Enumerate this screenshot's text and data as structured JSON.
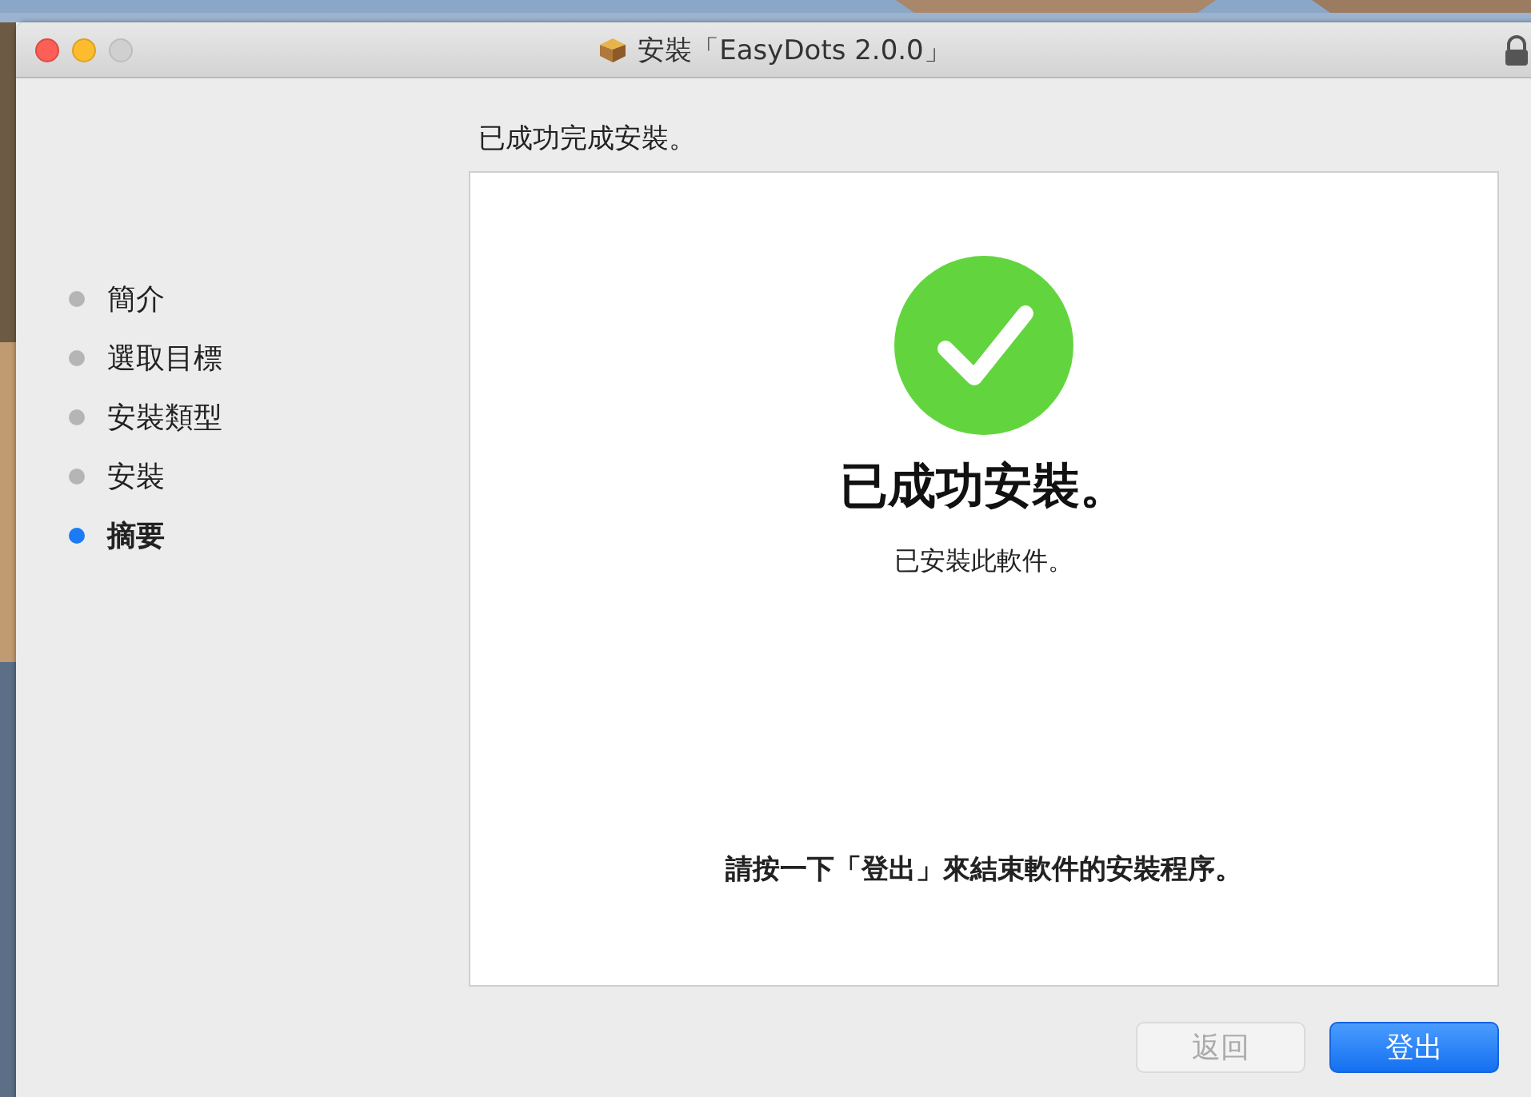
{
  "window": {
    "title": "安裝「EasyDots 2.0.0」"
  },
  "steps": [
    {
      "label": "簡介",
      "selected": false
    },
    {
      "label": "選取目標",
      "selected": false
    },
    {
      "label": "安裝類型",
      "selected": false
    },
    {
      "label": "安裝",
      "selected": false
    },
    {
      "label": "摘要",
      "selected": true
    }
  ],
  "heading": "已成功完成安裝。",
  "panel": {
    "title": "已成功安裝。",
    "subtitle": "已安裝此軟件。",
    "instruction": "請按一下「登出」來結束軟件的安裝程序。"
  },
  "buttons": [
    {
      "label": "返回",
      "disabled": true,
      "kind": "secondary"
    },
    {
      "label": "登出",
      "disabled": false,
      "kind": "primary"
    }
  ]
}
